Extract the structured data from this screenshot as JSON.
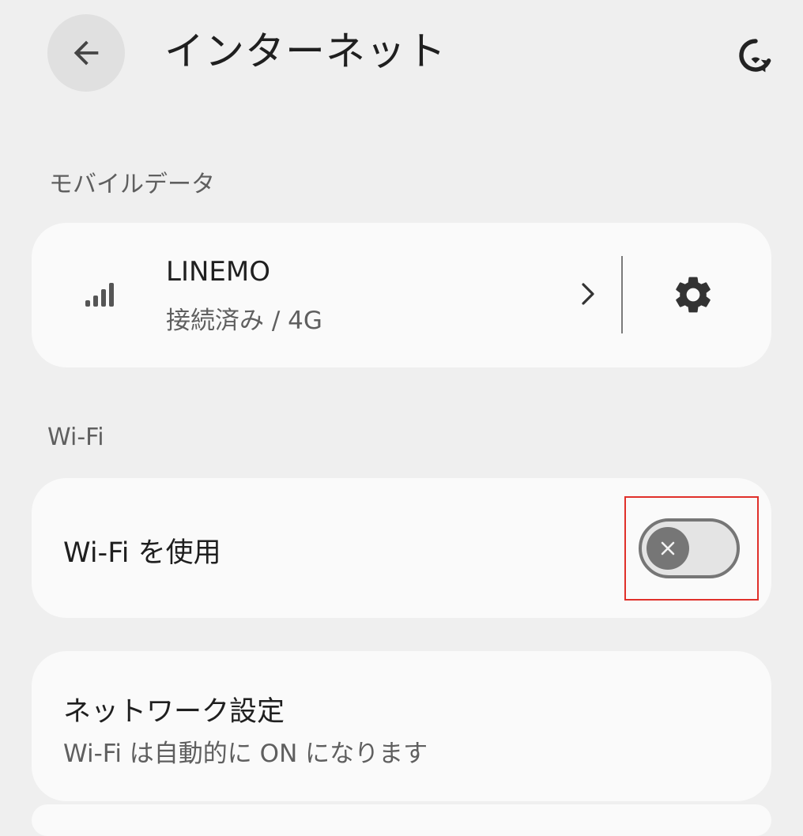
{
  "header": {
    "title": "インターネット",
    "back_icon": "arrow-back-icon",
    "reset_icon": "network-reset-icon"
  },
  "mobile_data": {
    "section_label": "モバイルデータ",
    "carrier": "LINEMO",
    "status": "接続済み / 4G",
    "signal_icon": "signal-bars-icon",
    "chevron_icon": "chevron-right-icon",
    "settings_icon": "gear-icon"
  },
  "wifi": {
    "section_label": "Wi-Fi",
    "toggle_label": "Wi-Fi を使用",
    "toggle_on": false,
    "highlight_color": "#e0302a"
  },
  "network_settings": {
    "title": "ネットワーク設定",
    "subtitle": "Wi-Fi は自動的に ON になります"
  }
}
